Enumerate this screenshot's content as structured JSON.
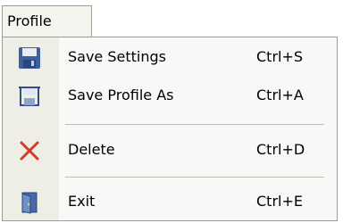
{
  "menu": {
    "title": "Profile",
    "items": [
      {
        "label": "Save Settings",
        "shortcut": "Ctrl+S",
        "icon": "floppy-disk-icon"
      },
      {
        "label": "Save Profile As",
        "shortcut": "Ctrl+A",
        "icon": "save-as-icon"
      },
      {
        "label": "Delete",
        "shortcut": "Ctrl+D",
        "icon": "delete-x-icon"
      },
      {
        "label": "Exit",
        "shortcut": "Ctrl+E",
        "icon": "exit-door-icon"
      }
    ]
  },
  "colors": {
    "menu_background": "#f8f8f6",
    "icon_strip": "#eeeee6",
    "border": "#9d9b94",
    "separator": "#bdbbb3",
    "delete_red": "#d23a2a",
    "floppy_blue": "#3d5f9c"
  }
}
